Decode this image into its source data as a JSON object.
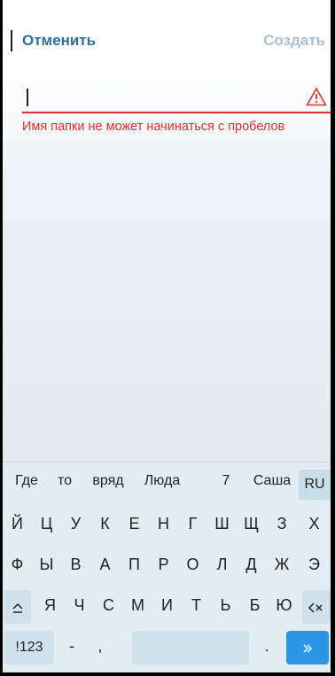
{
  "header": {
    "cancel_label": "Отменить",
    "create_label": "Создать"
  },
  "form": {
    "folder_name_value": "",
    "error_message": "Имя папки не может начинаться с пробелов",
    "warning_icon": "warning-triangle-icon"
  },
  "colors": {
    "accent": "#2e6e9e",
    "disabled": "#a9bfd1",
    "error": "#e0302e",
    "enter": "#2a97e6"
  },
  "keyboard": {
    "suggestions": [
      "Где",
      "то",
      "вряд",
      "Люда",
      "7",
      "Саша"
    ],
    "language": "RU",
    "row1": [
      "Й",
      "Ц",
      "У",
      "К",
      "Е",
      "Н",
      "Г",
      "Ш",
      "Щ",
      "З",
      "Х"
    ],
    "row2": [
      "Ф",
      "Ы",
      "В",
      "А",
      "П",
      "Р",
      "О",
      "Л",
      "Д",
      "Ж",
      "Э"
    ],
    "row3": [
      "Я",
      "Ч",
      "С",
      "М",
      "И",
      "Т",
      "Ь",
      "Б",
      "Ю"
    ],
    "shift_icon": "shift-icon",
    "backspace_icon": "backspace-icon",
    "numbers_label": "!123",
    "dash_label": "-",
    "comma_label": ",",
    "period_label": ".",
    "enter_icon": "double-chevron-right-icon"
  }
}
